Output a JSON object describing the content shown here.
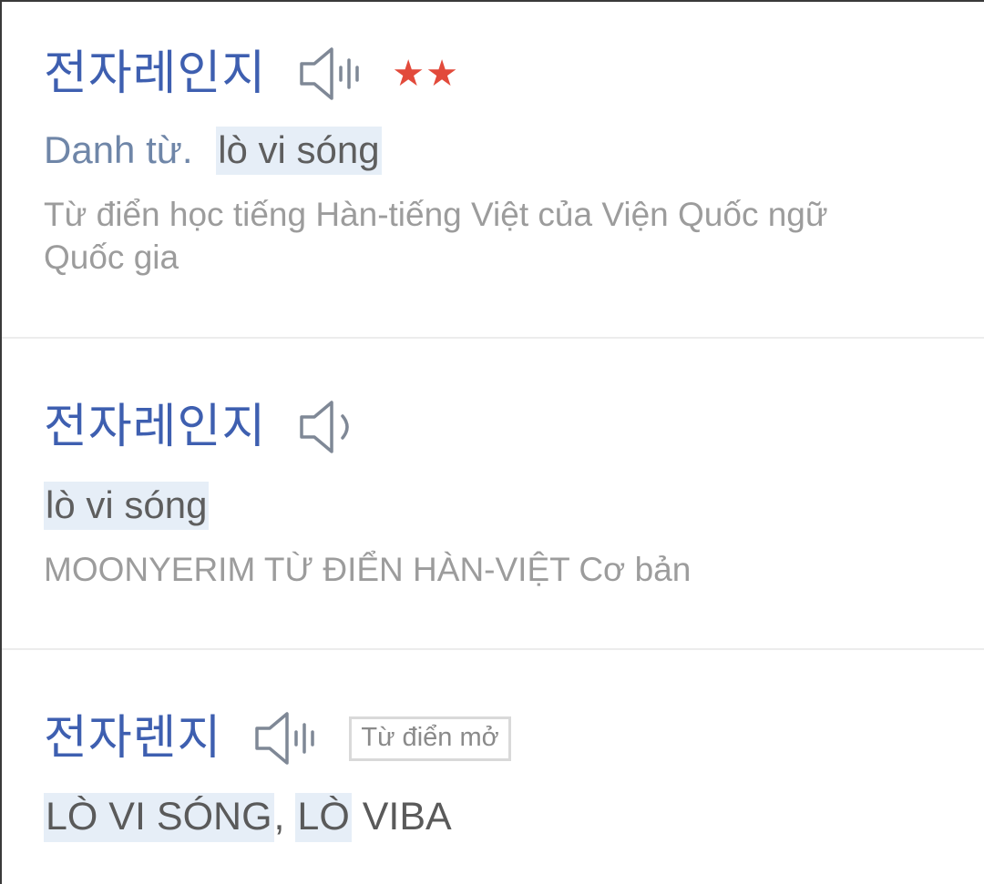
{
  "entries": [
    {
      "headword": "전자레인지",
      "stars": "★★",
      "pos": "Danh từ.",
      "meaning": "lò vi sóng",
      "source": "Từ điển học tiếng Hàn-tiếng Việt của Viện Quốc ngữ Quốc gia"
    },
    {
      "headword": "전자레인지",
      "meaning": "lò vi sóng",
      "source": "MOONYERIM TỪ ĐIỂN HÀN-VIỆT Cơ bản"
    },
    {
      "headword": "전자렌지",
      "badge": "Từ điển mở",
      "meaning_parts": [
        "LÒ VI SÓNG",
        ",",
        " ",
        "LÒ",
        " VIBA"
      ]
    }
  ],
  "colors": {
    "headword": "#3e5fb0",
    "star": "#e24a3b",
    "highlight": "#e6eef7",
    "pos": "#6f86a8",
    "source": "#9c9c9c"
  },
  "icons": [
    "speaker-bars-icon",
    "speaker-wave-icon",
    "star-icon"
  ]
}
